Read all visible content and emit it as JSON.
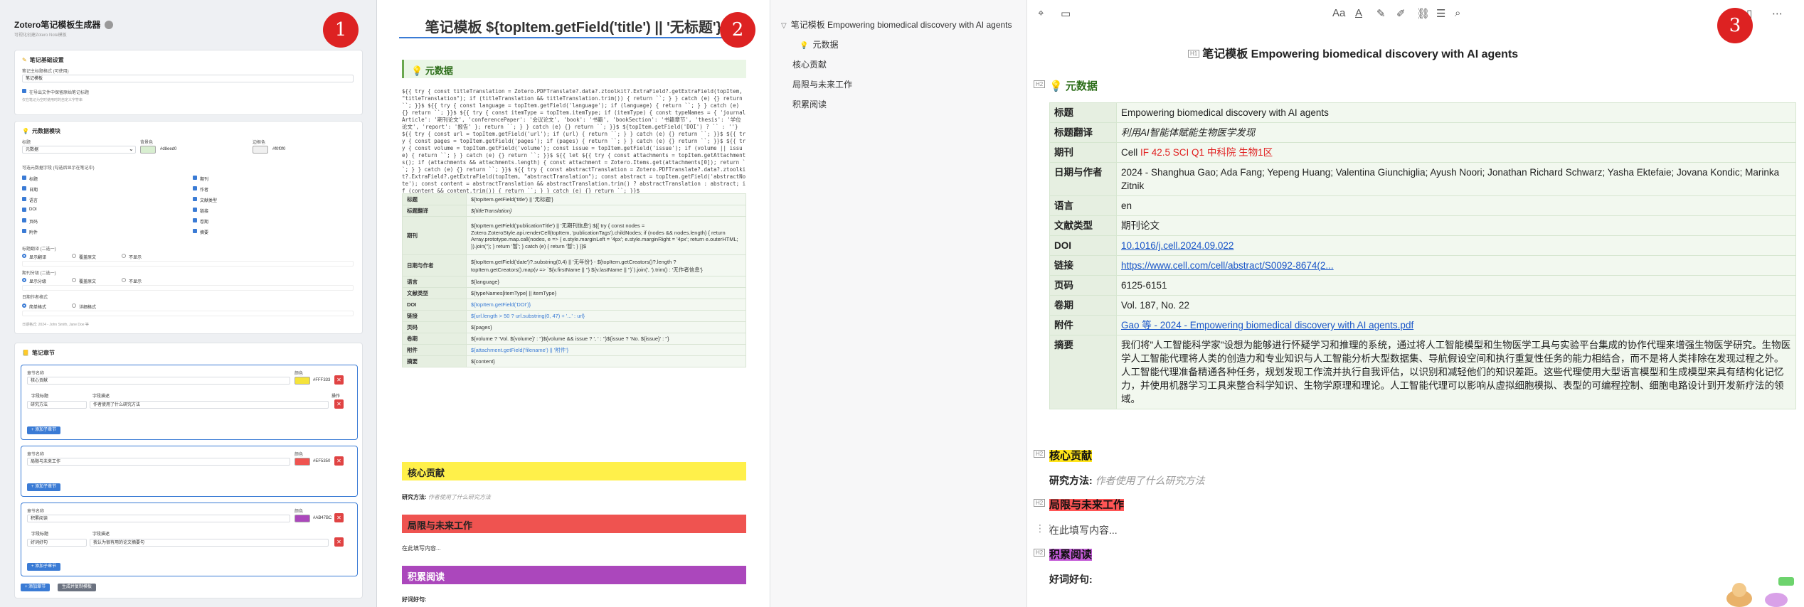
{
  "badges": {
    "b1": "1",
    "b2": "2",
    "b3": "3"
  },
  "generator": {
    "title": "Zotero笔记模板生成器",
    "subtitle": "可视化创建Zotero Note模板",
    "note_settings": {
      "title": "笔记基础设置",
      "title_label": "笔记主标题格式 (可使用)",
      "title_value": "笔记模板",
      "checkbox_label": "在导出文件中保留原始笔记标题",
      "hint": "仅在笔记为空时使用时的自定义字符串"
    },
    "meta_settings": {
      "title": "元数据模块",
      "label_title": "标题",
      "value_title": "元数据",
      "label_bg": "背景色",
      "value_bg": "#d8eed0",
      "label_border": "边框色",
      "value_border": "#f0f0f0",
      "fields_label": "可选元数据字段 (勾选后显示在笔记中)",
      "fields_left": [
        "标题",
        "日期",
        "语言",
        "DOI",
        "页码",
        "附件"
      ],
      "fields_right": [
        "期刊",
        "作者",
        "文献类型",
        "链接",
        "卷期",
        "摘要"
      ],
      "opt1_label": "标题翻译 (二选一)",
      "opt1": [
        "显示翻译",
        "覆盖原文",
        "不显示"
      ],
      "opt2_label": "期刊分级 (二选一)",
      "opt2": [
        "显示分级",
        "覆盖原文",
        "不显示"
      ],
      "opt3_label": "日期作者格式",
      "opt3": [
        "简单格式",
        "详细格式"
      ],
      "opt3_hint": "日期格式: 2024 - John Smith, Jane Doe 等"
    },
    "sections_card": {
      "title": "笔记章节",
      "sections": [
        {
          "name_label": "章节名称",
          "name": "核心贡献",
          "color_label": "颜色",
          "color": "#FFF333",
          "swatch": "#f5e33a",
          "col1": "字段标题",
          "col2": "字段描述",
          "col3": "操作",
          "row_title": "研究方法",
          "row_desc": "作者使用了什么研究方法",
          "add": "+ 添加子章节"
        },
        {
          "name_label": "章节名称",
          "name": "局限与未来工作",
          "color_label": "颜色",
          "color": "#EF5350",
          "swatch": "#ef5350",
          "add": "+ 添加子章节"
        },
        {
          "name_label": "章节名称",
          "name": "积累阅读",
          "color_label": "颜色",
          "color": "#AB47BC",
          "swatch": "#ab47bc",
          "col1": "字段标题",
          "col2": "字段描述",
          "row_title": "好词好句",
          "row_desc": "我认为很有用的论文摘要句",
          "add": "+ 添加子章节"
        }
      ],
      "add_section": "+ 添加章节",
      "copy_btn": "生成并复制模板"
    }
  },
  "template_preview": {
    "title": "笔记模板 ${topItem.getField('title') || '无标题'}",
    "meta_header": "元数据",
    "code": "${{ try { const titleTranslation = Zotero.PDFTranslate?.data?.ztoolkit?.ExtraField?.getExtraField(topItem, \"titleTranslation\"); if (titleTranslation && titleTranslation.trim()) { return ``; } } catch (e) {} return ``; }}$ ${{ try { const language = topItem.getField('language'); if (language) { return ``; } } catch (e) {} return ``; }}$ ${{ try { const itemType = topItem.itemType; if (itemType) { const typeNames = { 'journalArticle': '期刊论文', 'conferencePaper': '会议论文', 'book': '书籍', 'bookSection': '书籍章节', 'thesis': '学位论文', 'report': '报告' }; return ``; } } catch (e) {} return ``; }}$ ${topItem.getField('DOI') ? `` : ''} ${{ try { const url = topItem.getField('url'); if (url) { return ``; } } catch (e) {} return ``; }}$ ${{ try { const pages = topItem.getField('pages'); if (pages) { return ``; } } catch (e) {} return ``; }}$ ${{ try { const volume = topItem.getField('volume'); const issue = topItem.getField('issue'); if (volume || issue) { return ``; } } catch (e) {} return ``; }}$ ${{ let ${{ try { const attachments = topItem.getAttachments(); if (attachments && attachments.length) { const attachment = Zotero.Items.get(attachments[0]); return ``; } } catch (e) {} return ``; }}$ ${{ try { const abstractTranslation = Zotero.PDFTranslate?.data?.ztoolkit?.ExtraField?.getExtraField(topItem, \"abstractTranslation\"); const abstract = topItem.getField('abstractNote'); const content = abstractTranslation && abstractTranslation.trim() ? abstractTranslation : abstract; if (content && content.trim()) { return ``; } } catch (e) {} return ``; }}$",
    "rows": [
      {
        "k": "标题",
        "v": "${topItem.getField('title') || '无标题'}",
        "blue": false,
        "h": 16
      },
      {
        "k": "标题翻译",
        "v": "${titleTranslation}",
        "blue": false,
        "h": 16,
        "it": true
      },
      {
        "k": "期刊",
        "v": "${topItem.getField('publicationTitle') || '无期刊信息'} ${{ try { const nodes = Zotero.ZoteroStyle.api.renderCell(topItem, 'publicationTags').childNodes; if (nodes && nodes.length) { return Array.prototype.map.call(nodes, e => { e.style.marginLeft = '4px'; e.style.marginRight = '4px'; return e.outerHTML; }).join(''); } return '暂'; } catch (e) { return '暂'; } }}$",
        "blue": false,
        "h": 54
      },
      {
        "k": "日期与作者",
        "v": "${topItem.getField('date')?.substring(0,4) || '无年份'} - ${topItem.getCreators()?.length ? topItem.getCreators().map(v => `${v.firstName || ''} ${v.lastName || ''}`).join(', ').trim() : '无作者信息'}",
        "blue": false,
        "h": 30
      },
      {
        "k": "语言",
        "v": "${language}",
        "blue": false,
        "h": 16
      },
      {
        "k": "文献类型",
        "v": "${typeNames[itemType] || itemType}",
        "blue": false,
        "h": 16
      },
      {
        "k": "DOI",
        "v": "${topItem.getField('DOI')}",
        "blue": true,
        "h": 16
      },
      {
        "k": "链接",
        "v": "${url.length > 50 ? url.substring(0, 47) + '...' : url}",
        "blue": true,
        "h": 16
      },
      {
        "k": "页码",
        "v": "${pages}",
        "blue": false,
        "h": 16
      },
      {
        "k": "卷期",
        "v": "${volume ? 'Vol. ${volume}' : ''}${volume && issue ? ', ' : ''}${issue ? 'No. ${issue}' : ''}",
        "blue": false,
        "h": 16
      },
      {
        "k": "附件",
        "v": "${attachment.getField('filename') || '附件'}",
        "blue": true,
        "h": 16
      },
      {
        "k": "摘要",
        "v": "${content}",
        "blue": false,
        "h": 16
      }
    ],
    "sec1": "核心贡献",
    "sec1_field": "研究方法:",
    "sec1_ph": "作者使用了什么研究方法",
    "sec2": "局限与未来工作",
    "sec2_ph": "在此填写内容...",
    "sec3": "积累阅读",
    "sec3_field": "好词好句:"
  },
  "outline": {
    "items": [
      {
        "label": "笔记模板 Empowering biomedical discovery with AI agents",
        "icon": "▽"
      },
      {
        "label": "元数据",
        "icon": "💡"
      },
      {
        "label": "核心贡献",
        "icon": ""
      },
      {
        "label": "局限与未来工作",
        "icon": ""
      },
      {
        "label": "积累阅读",
        "icon": ""
      }
    ]
  },
  "note": {
    "toolbar": [
      "Aa",
      "A",
      "✎",
      "✐",
      "⌕"
    ],
    "title": "笔记模板 Empowering biomedical discovery with AI agents",
    "meta_header": "元数据",
    "rows": {
      "title": {
        "k": "标题",
        "v": "Empowering biomedical discovery with AI agents"
      },
      "title_tr": {
        "k": "标题翻译",
        "v": "利用AI智能体赋能生物医学发现"
      },
      "journal": {
        "k": "期刊",
        "v": "Cell",
        "tags": "IF 42.5 SCI Q1 中科院 生物1区"
      },
      "date": {
        "k": "日期与作者",
        "v": "2024 - Shanghua Gao; Ada Fang; Yepeng Huang; Valentina Giunchiglia; Ayush Noori; Jonathan Richard Schwarz; Yasha Ektefaie; Jovana Kondic; Marinka Zitnik"
      },
      "lang": {
        "k": "语言",
        "v": "en"
      },
      "type": {
        "k": "文献类型",
        "v": "期刊论文"
      },
      "doi": {
        "k": "DOI",
        "v": "10.1016/j.cell.2024.09.022"
      },
      "url": {
        "k": "链接",
        "v": "https://www.cell.com/cell/abstract/S0092-8674(2..."
      },
      "pages": {
        "k": "页码",
        "v": "6125-6151"
      },
      "vol": {
        "k": "卷期",
        "v": "Vol. 187, No. 22"
      },
      "att": {
        "k": "附件",
        "v": "Gao 等 - 2024 - Empowering biomedical discovery with AI agents.pdf"
      },
      "abs": {
        "k": "摘要",
        "v": "我们将\"人工智能科学家\"设想为能够进行怀疑学习和推理的系统，通过将人工智能模型和生物医学工具与实验平台集成的协作代理来增强生物医学研究。生物医学人工智能代理将人类的创造力和专业知识与人工智能分析大型数据集、导航假设空间和执行重复性任务的能力相结合，而不是将人类排除在发现过程之外。人工智能代理准备精通各种任务，规划发现工作流并执行自我评估，以识别和减轻他们的知识差距。这些代理使用大型语言模型和生成模型来具有结构化记忆力，并使用机器学习工具来整合科学知识、生物学原理和理论。人工智能代理可以影响从虚拟细胞模拟、表型的可编程控制、细胞电路设计到开发新疗法的领域。"
      }
    },
    "sec1": "核心贡献",
    "sec1_field": "研究方法:",
    "sec1_ph": "作者使用了什么研究方法",
    "sec2": "局限与未来工作",
    "sec2_ph": "在此填写内容...",
    "sec3": "积累阅读",
    "sec3_field": "好词好句:",
    "h1tag": "H1",
    "h2tag": "H2"
  }
}
